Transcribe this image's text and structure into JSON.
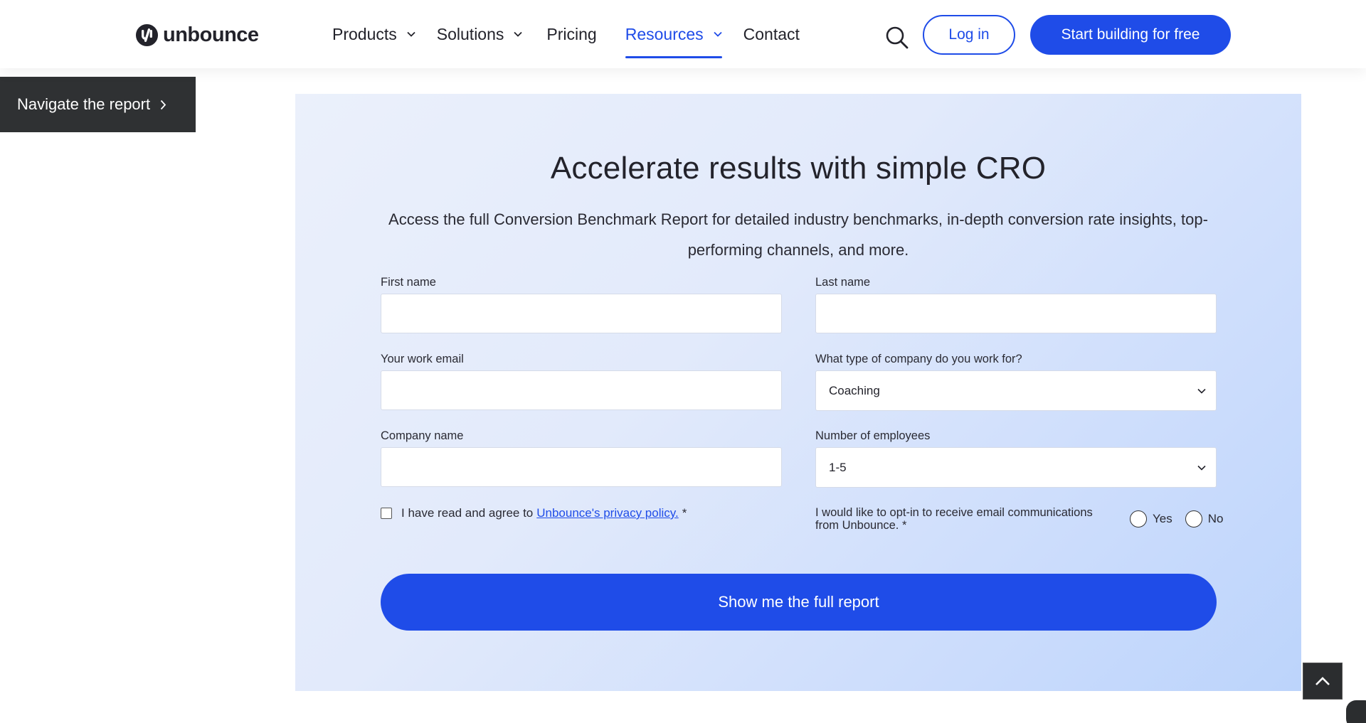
{
  "header": {
    "logo_text": "unbounce",
    "nav": [
      {
        "label": "Products",
        "has_dropdown": true,
        "active": false
      },
      {
        "label": "Solutions",
        "has_dropdown": true,
        "active": false
      },
      {
        "label": "Pricing",
        "has_dropdown": false,
        "active": false
      },
      {
        "label": "Resources",
        "has_dropdown": true,
        "active": true
      },
      {
        "label": "Contact",
        "has_dropdown": false,
        "active": false
      }
    ],
    "search_icon": "search-icon",
    "login_label": "Log in",
    "start_label": "Start building for free"
  },
  "report_nav": {
    "label": "Navigate the report",
    "icon": "chevron-right-icon"
  },
  "form": {
    "title": "Accelerate results with simple CRO",
    "description": "Access the full Conversion Benchmark Report for detailed industry benchmarks, in-depth conversion rate insights, top-performing channels, and more.",
    "fields": {
      "first_name": {
        "label": "First name",
        "value": ""
      },
      "last_name": {
        "label": "Last name",
        "value": ""
      },
      "email": {
        "label": "Your work email",
        "value": ""
      },
      "company_type": {
        "label": "What type of company do you work for?",
        "selected": "Coaching"
      },
      "company_name": {
        "label": "Company name",
        "value": ""
      },
      "employees": {
        "label": "Number of employees",
        "selected": "1-5"
      }
    },
    "consent": {
      "text": "I have read and agree to",
      "link": "Unbounce's privacy policy.",
      "required_mark": "*",
      "checked": false
    },
    "optin": {
      "text": "I would like to opt-in to receive email communications from Unbounce. *",
      "yes_label": "Yes",
      "no_label": "No"
    },
    "submit_label": "Show me the full report"
  },
  "back_to_top_icon": "chevron-up-icon",
  "colors": {
    "accent": "#1f4ce8",
    "dark": "#2f3133",
    "card_gradient_start": "#ebf0fb",
    "card_gradient_end": "#bcd4fb"
  }
}
